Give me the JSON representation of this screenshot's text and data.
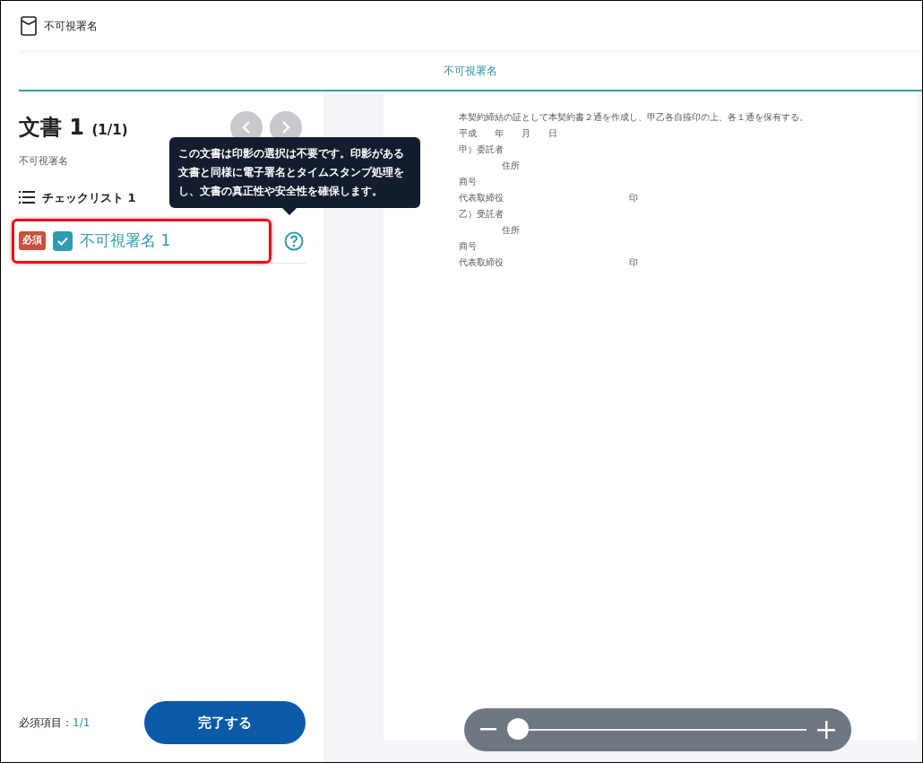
{
  "header": {
    "title": "不可視署名"
  },
  "tabs": [
    {
      "label": "不可視署名",
      "selected": true
    }
  ],
  "document": {
    "title": "文書 1",
    "count": "(1/1)",
    "subtitle": "不可視署名"
  },
  "checklist": {
    "title": "チェックリスト 1",
    "items": [
      {
        "badge": "必須",
        "label": "不可視署名 1",
        "checked": true,
        "highlighted": true
      }
    ]
  },
  "tooltip": {
    "text": "この文書は印影の選択は不要です。印影がある文書と同様に電子署名とタイムスタンプ処理をし、文書の真正性や安全性を確保します。"
  },
  "footer": {
    "label": "必須項目：",
    "value": "1/1",
    "button": "完了する"
  },
  "page_lines": [
    {
      "kind": "plain",
      "text": "本契約締結の証として本契約書２通を作成し、甲乙各自捺印の上、各１通を保有する。"
    },
    {
      "kind": "plain",
      "text": "平成　　年　　月　　日"
    },
    {
      "kind": "plain",
      "text": "甲）委託者"
    },
    {
      "kind": "indent",
      "text": "住所"
    },
    {
      "kind": "plain",
      "text": "商号"
    },
    {
      "kind": "seal",
      "text": "代表取締役",
      "seal": "印"
    },
    {
      "kind": "plain",
      "text": "乙）受託者"
    },
    {
      "kind": "indent",
      "text": "住所"
    },
    {
      "kind": "plain",
      "text": "商号"
    },
    {
      "kind": "seal",
      "text": "代表取締役",
      "seal": "印"
    }
  ],
  "zoom": {
    "level": 0
  }
}
